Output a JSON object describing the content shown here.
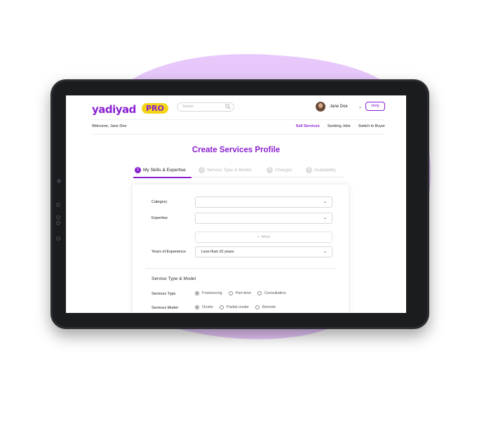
{
  "brand": {
    "logo_text": "yadiyad",
    "badge": "PRO",
    "accent": "#8a1fd1",
    "badge_color": "#f3d516"
  },
  "search": {
    "placeholder": "Search"
  },
  "user": {
    "name": "Jane Doe"
  },
  "header": {
    "help_label": "Help",
    "welcome": "Welcome, Jane Doe"
  },
  "nav": {
    "items": [
      {
        "label": "Sell Services",
        "active": true
      },
      {
        "label": "Seeking Jobs"
      },
      {
        "label": "Switch to Buyer"
      }
    ]
  },
  "page": {
    "title": "Create Services Profile"
  },
  "steps": [
    {
      "num": "1",
      "label": "My Skills & Expertise",
      "active": true
    },
    {
      "num": "2",
      "label": "Service Type & Model"
    },
    {
      "num": "3",
      "label": "Charges"
    },
    {
      "num": "4",
      "label": "Availability"
    }
  ],
  "form": {
    "category_label": "Category",
    "category_value": "",
    "expertise_label": "Expertise",
    "expertise_value": "",
    "more_label": "More",
    "years_label": "Years of Experience",
    "years_value": "Less than 10 years",
    "section_title": "Service Type & Model",
    "services_type_label": "Services Type",
    "services_type_options": [
      {
        "label": "Freelancing",
        "selected": true
      },
      {
        "label": "Part-time"
      },
      {
        "label": "Consultation"
      }
    ],
    "services_model_label": "Services Model",
    "services_model_options": [
      {
        "label": "Onsite",
        "selected": true
      },
      {
        "label": "Partial onsite"
      },
      {
        "label": "Remote"
      }
    ]
  }
}
